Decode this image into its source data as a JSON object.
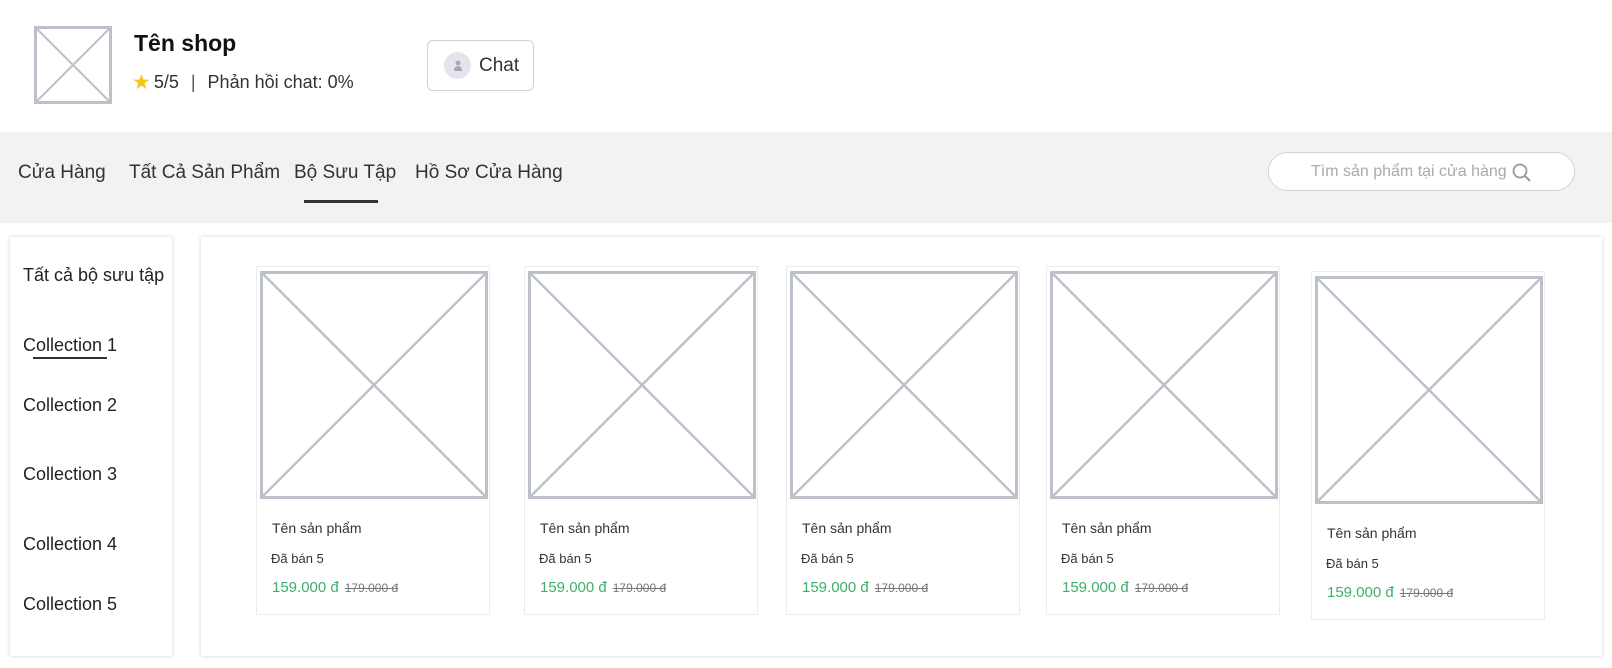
{
  "shop": {
    "name": "Tên shop",
    "rating": "5/5",
    "separator": "|",
    "chat_response": "Phản hồi chat: 0%",
    "chat_button": "Chat",
    "star_color": "#f5c518"
  },
  "nav": {
    "tabs": [
      {
        "label": "Cửa Hàng"
      },
      {
        "label": "Tất Cả Sản Phẩm"
      },
      {
        "label": "Bộ Sưu Tập",
        "active": true
      },
      {
        "label": "Hồ Sơ Cửa Hàng"
      }
    ],
    "search_placeholder": "Tìm sản phẩm tại cửa hàng"
  },
  "sidebar": {
    "items": [
      {
        "label": "Tất cả bộ sưu tập"
      },
      {
        "label": "Collection 1",
        "active": true
      },
      {
        "label": "Collection 2"
      },
      {
        "label": "Collection 3"
      },
      {
        "label": "Collection 4"
      },
      {
        "label": "Collection 5"
      }
    ]
  },
  "products": [
    {
      "name": "Tên sản phẩm",
      "sold": "Đã bán 5",
      "price": "159.000 đ",
      "old_price": "179.000 đ"
    },
    {
      "name": "Tên sản phẩm",
      "sold": "Đã bán 5",
      "price": "159.000 đ",
      "old_price": "179.000 đ"
    },
    {
      "name": "Tên sản phẩm",
      "sold": "Đã bán 5",
      "price": "159.000 đ",
      "old_price": "179.000 đ"
    },
    {
      "name": "Tên sản phẩm",
      "sold": "Đã bán 5",
      "price": "159.000 đ",
      "old_price": "179.000 đ"
    },
    {
      "name": "Tên sản phẩm",
      "sold": "Đã bán 5",
      "price": "159.000 đ",
      "old_price": "179.000 đ"
    }
  ],
  "colors": {
    "price": "#3fae6b",
    "navbar_bg": "#f2f2f2",
    "placeholder_stroke": "#bcc0c9"
  }
}
